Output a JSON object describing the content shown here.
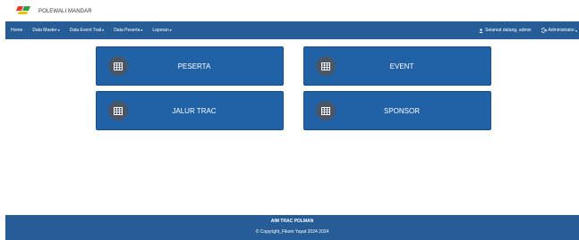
{
  "header": {
    "brand_top": "",
    "brand": "POLEWALI MANDAR"
  },
  "navbar": {
    "items": [
      {
        "label": "Home",
        "dropdown": false
      },
      {
        "label": "Data Master",
        "dropdown": true
      },
      {
        "label": "Data Event Trail",
        "dropdown": true
      },
      {
        "label": "Data Peserta",
        "dropdown": true
      },
      {
        "label": "Laporan",
        "dropdown": true
      }
    ],
    "welcome": "Selamat datang, admin",
    "account": "Administrator",
    "caret": "▾"
  },
  "cards": [
    {
      "label": "PESERTA",
      "icon": "table-icon"
    },
    {
      "label": "EVENT",
      "icon": "table-icon"
    },
    {
      "label": "JALUR TRAC",
      "icon": "table-icon"
    },
    {
      "label": "SPONSOR",
      "icon": "table-icon"
    }
  ],
  "footer": {
    "title": "AIM TRAC POLMAN",
    "copyright": "© Copyright_Fikom Yayat 2024 2024"
  },
  "colors": {
    "navbar": "#265d97",
    "card": "#2161a6",
    "card_icon_bg": "#4a5663",
    "text_light": "#ffffff"
  }
}
